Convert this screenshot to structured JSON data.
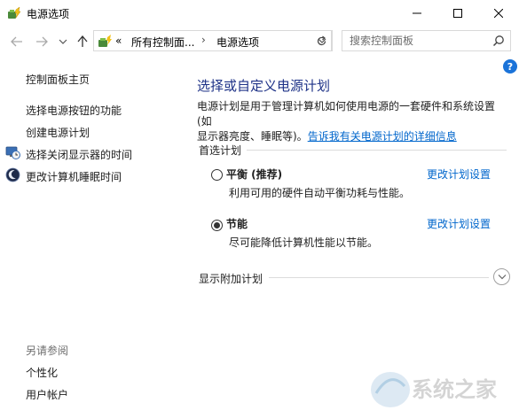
{
  "window": {
    "title": "电源选项",
    "icon": "power-options-icon"
  },
  "nav": {
    "back_icon": "back-arrow-icon",
    "forward_icon": "forward-arrow-icon",
    "dropdown_icon": "chevron-down-icon",
    "up_icon": "up-arrow-icon",
    "address": {
      "overflow": "«",
      "segment1": "所有控制面...",
      "separator": "›",
      "segment2": "电源选项"
    },
    "search_placeholder": "搜索控制面板"
  },
  "sidebar": {
    "home": "控制面板主页",
    "items": [
      {
        "label": "选择电源按钮的功能"
      },
      {
        "label": "创建电源计划"
      },
      {
        "label": "选择关闭显示器的时间",
        "icon": "monitor-clock-icon"
      },
      {
        "label": "更改计算机睡眠时间",
        "icon": "moon-sleep-icon"
      }
    ],
    "see_also_label": "另请参阅",
    "see_also": [
      {
        "label": "个性化"
      },
      {
        "label": "用户帐户"
      }
    ]
  },
  "main": {
    "title": "选择或自定义电源计划",
    "description_line1": "电源计划是用于管理计算机如何使用电源的一套硬件和系统设置(如",
    "description_line2_prefix": "显示器亮度、睡眠等)。",
    "description_link": "告诉我有关电源计划的详细信息",
    "preferred_label": "首选计划",
    "plans": [
      {
        "name": "平衡 (推荐)",
        "desc": "利用可用的硬件自动平衡功耗与性能。",
        "link": "更改计划设置",
        "selected": false
      },
      {
        "name": "节能",
        "desc": "尽可能降低计算机性能以节能。",
        "link": "更改计划设置",
        "selected": true
      }
    ],
    "more_plans_label": "显示附加计划"
  },
  "help_label": "?",
  "watermark_text": "系统之家"
}
